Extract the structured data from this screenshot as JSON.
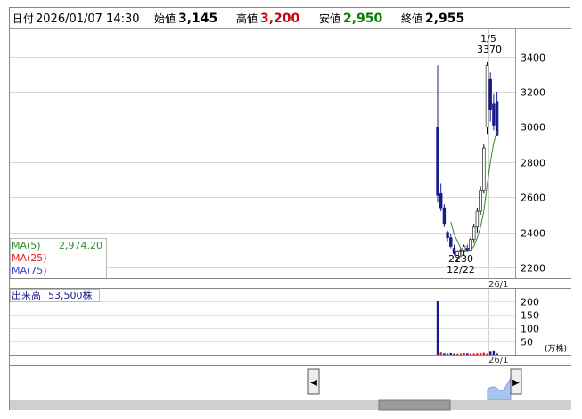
{
  "header": {
    "date_label": "日付",
    "datetime": "2026/01/07 14:30",
    "open_label": "始値",
    "open": "3,145",
    "high_label": "高値",
    "high": "3,200",
    "low_label": "安値",
    "low": "2,950",
    "close_label": "終値",
    "close": "2,955"
  },
  "ma_legend": {
    "ma5": "MA(5)",
    "ma5_value": "2,974.20",
    "ma25": "MA(25)",
    "ma75": "MA(75)"
  },
  "annotations": {
    "high_date": "1/5",
    "high_value": "3370",
    "low_value": "2230",
    "low_date": "12/22",
    "month_tick": "26/1",
    "month_tick_volume": "26/1"
  },
  "volume_panel": {
    "label": "出来高",
    "value": "53,500株",
    "unit": "(万株)"
  },
  "colors": {
    "up": "#ffffff",
    "down": "#1a1a8c",
    "ma5": "#2e8b2e",
    "volume_red": "#e02020",
    "volume_blue": "#1a1a8c",
    "high_text": "#cc0000",
    "low_text": "#008000",
    "navigator_fill": "#a9c4ee"
  },
  "chart_data": {
    "type": "candlestick",
    "price_axis": {
      "ticks": [
        2200,
        2400,
        2600,
        2800,
        3000,
        3200,
        3400
      ],
      "range": [
        2140,
        3560
      ]
    },
    "volume_axis": {
      "ticks": [
        50,
        100,
        150,
        200
      ],
      "range": [
        0,
        230
      ]
    },
    "candles": [
      {
        "o": 3000,
        "h": 3350,
        "l": 2570,
        "c": 2610
      },
      {
        "o": 2620,
        "h": 2680,
        "l": 2520,
        "c": 2540
      },
      {
        "o": 2540,
        "h": 2560,
        "l": 2430,
        "c": 2450
      },
      {
        "o": 2400,
        "h": 2410,
        "l": 2350,
        "c": 2370
      },
      {
        "o": 2370,
        "h": 2390,
        "l": 2310,
        "c": 2320
      },
      {
        "o": 2310,
        "h": 2330,
        "l": 2270,
        "c": 2280
      },
      {
        "o": 2260,
        "h": 2300,
        "l": 2230,
        "c": 2290
      },
      {
        "o": 2290,
        "h": 2310,
        "l": 2260,
        "c": 2300
      },
      {
        "o": 2290,
        "h": 2330,
        "l": 2270,
        "c": 2320
      },
      {
        "o": 2310,
        "h": 2330,
        "l": 2290,
        "c": 2300
      },
      {
        "o": 2300,
        "h": 2370,
        "l": 2290,
        "c": 2360
      },
      {
        "o": 2360,
        "h": 2450,
        "l": 2340,
        "c": 2430
      },
      {
        "o": 2430,
        "h": 2540,
        "l": 2400,
        "c": 2520
      },
      {
        "o": 2520,
        "h": 2660,
        "l": 2500,
        "c": 2640
      },
      {
        "o": 2640,
        "h": 2900,
        "l": 2620,
        "c": 2880
      },
      {
        "o": 3000,
        "h": 3370,
        "l": 2960,
        "c": 3350
      },
      {
        "o": 3270,
        "h": 3310,
        "l": 3030,
        "c": 3100
      },
      {
        "o": 3130,
        "h": 3190,
        "l": 2980,
        "c": 3010
      },
      {
        "o": 3145,
        "h": 3200,
        "l": 2950,
        "c": 2955
      }
    ],
    "ma5": [
      null,
      null,
      null,
      null,
      2460,
      2390,
      2350,
      2310,
      2300,
      2290,
      2300,
      2320,
      2370,
      2430,
      2520,
      2670,
      2800,
      2910,
      2974.2
    ],
    "volume": [
      200,
      9,
      6,
      5,
      7,
      5,
      4,
      5,
      7,
      6,
      5,
      5,
      6,
      7,
      8,
      5,
      12,
      14,
      5
    ],
    "volume_up": [
      false,
      true,
      false,
      false,
      false,
      false,
      true,
      true,
      true,
      false,
      true,
      true,
      true,
      true,
      true,
      true,
      false,
      false,
      false
    ]
  }
}
